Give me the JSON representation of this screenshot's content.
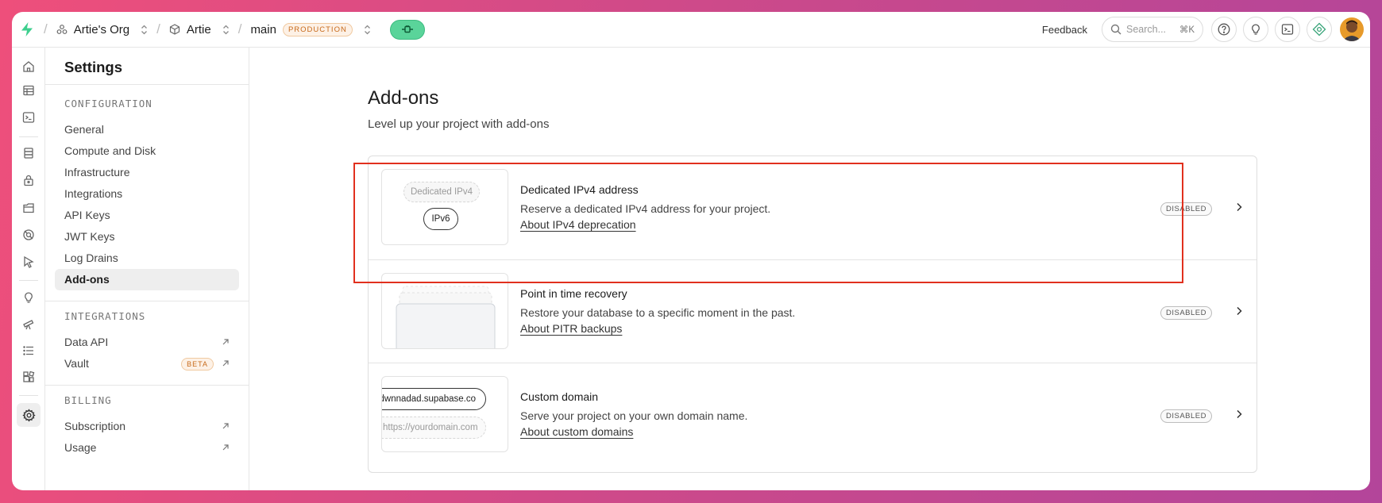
{
  "topbar": {
    "org": "Artie's Org",
    "project": "Artie",
    "branch": "main",
    "env_badge": "PRODUCTION",
    "feedback": "Feedback",
    "search_placeholder": "Search...",
    "search_shortcut": "⌘K"
  },
  "rail_icons": [
    "home-icon",
    "table-editor-icon",
    "sql-editor-icon",
    "database-icon",
    "auth-icon",
    "storage-icon",
    "realtime-icon",
    "edge-functions-icon",
    "advisors-icon",
    "reports-icon",
    "logs-icon",
    "integrations-icon",
    "settings-icon"
  ],
  "sidebar": {
    "title": "Settings",
    "configuration": {
      "heading": "CONFIGURATION",
      "items": [
        "General",
        "Compute and Disk",
        "Infrastructure",
        "Integrations",
        "API Keys",
        "JWT Keys",
        "Log Drains",
        "Add-ons"
      ],
      "selected": "Add-ons"
    },
    "integrations": {
      "heading": "INTEGRATIONS",
      "items": [
        {
          "label": "Data API"
        },
        {
          "label": "Vault",
          "badge": "BETA"
        }
      ]
    },
    "billing": {
      "heading": "BILLING",
      "items": [
        {
          "label": "Subscription"
        },
        {
          "label": "Usage"
        }
      ]
    }
  },
  "main": {
    "title": "Add-ons",
    "subtitle": "Level up your project with add-ons",
    "addons": [
      {
        "title": "Dedicated IPv4 address",
        "description": "Reserve a dedicated IPv4 address for your project.",
        "link": "About IPv4 deprecation",
        "status": "DISABLED",
        "thumb": {
          "ghost": "Dedicated IPv4",
          "pill": "IPv6"
        }
      },
      {
        "title": "Point in time recovery",
        "description": "Restore your database to a specific moment in the past.",
        "link": "About PITR backups",
        "status": "DISABLED"
      },
      {
        "title": "Custom domain",
        "description": "Serve your project on your own domain name.",
        "link": "About custom domains",
        "status": "DISABLED",
        "thumb": {
          "url": "vdwnnadad.supabase.co",
          "placeholder": "https://yourdomain.com"
        }
      }
    ]
  },
  "colors": {
    "accent": "#3ecf8e",
    "highlight": "#e1301e",
    "badge_orange": "#c76a1b"
  }
}
